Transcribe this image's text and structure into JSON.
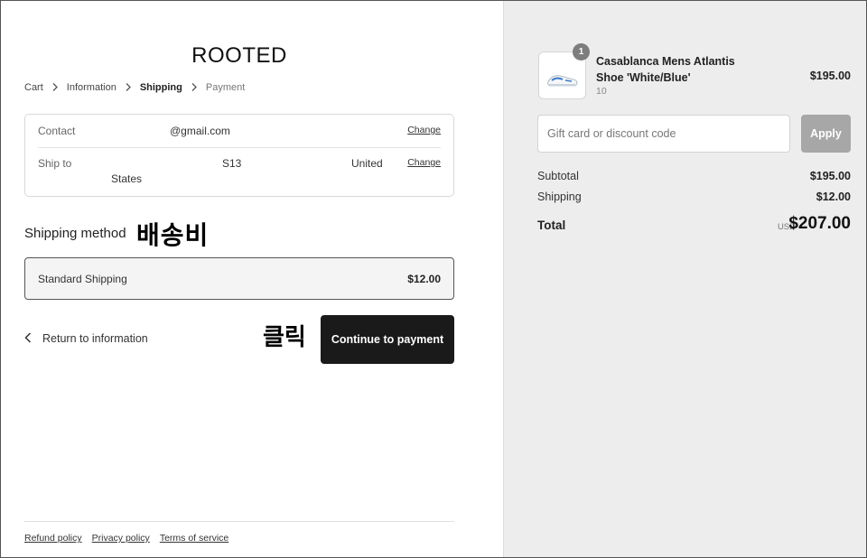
{
  "store": {
    "name": "ROOTED"
  },
  "breadcrumb": {
    "items": [
      "Cart",
      "Information",
      "Shipping",
      "Payment"
    ],
    "current_index": 2
  },
  "contact": {
    "label": "Contact",
    "value": "@gmail.com",
    "change": "Change"
  },
  "ship_to": {
    "label": "Ship to",
    "parts": [
      "S13",
      "United",
      "States"
    ],
    "change": "Change"
  },
  "shipping_method": {
    "heading": "Shipping method",
    "annotation": "배송비",
    "option": {
      "name": "Standard Shipping",
      "price": "$12.00"
    }
  },
  "actions": {
    "return_label": "Return to information",
    "annotation": "클릭",
    "continue_label": "Continue to payment"
  },
  "footer": {
    "links": [
      "Refund policy",
      "Privacy policy",
      "Terms of service"
    ]
  },
  "order": {
    "product": {
      "name": "Casablanca Mens Atlantis Shoe 'White/Blue'",
      "variant": "10",
      "price": "$195.00",
      "quantity": "1"
    },
    "discount": {
      "placeholder": "Gift card or discount code",
      "apply_label": "Apply"
    },
    "subtotal": {
      "label": "Subtotal",
      "value": "$195.00"
    },
    "shipping": {
      "label": "Shipping",
      "value": "$12.00"
    },
    "total": {
      "label": "Total",
      "currency": "USD",
      "value": "$207.00"
    }
  },
  "colors": {
    "primary_button": "#1a1a1a",
    "apply_button": "#a7a7a7",
    "summary_background": "#ededed",
    "selected_option_background": "#f4f4f4"
  }
}
